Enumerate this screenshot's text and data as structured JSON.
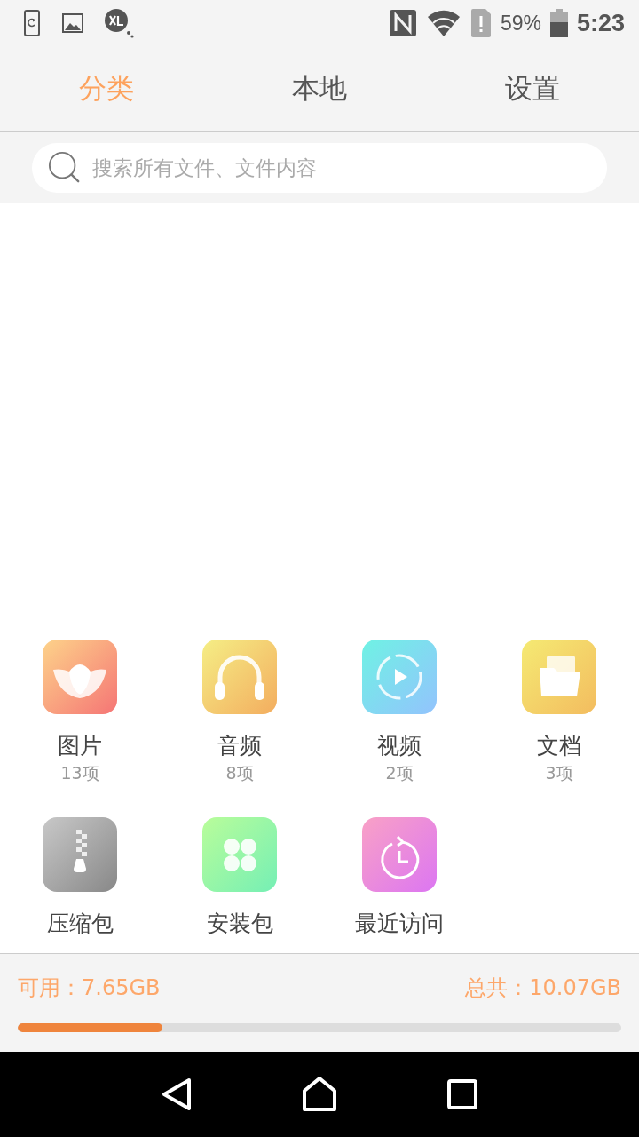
{
  "status_bar": {
    "battery_text": "59%",
    "time": "5:23"
  },
  "tabs": [
    {
      "label": "分类",
      "selected": true
    },
    {
      "label": "本地",
      "selected": false
    },
    {
      "label": "设置",
      "selected": false
    }
  ],
  "search": {
    "placeholder": "搜索所有文件、文件内容"
  },
  "categories": [
    {
      "kind": "pictures",
      "label": "图片",
      "count": "13项"
    },
    {
      "kind": "audio",
      "label": "音频",
      "count": "8项"
    },
    {
      "kind": "video",
      "label": "视频",
      "count": "2项"
    },
    {
      "kind": "documents",
      "label": "文档",
      "count": "3项"
    },
    {
      "kind": "archives",
      "label": "压缩包"
    },
    {
      "kind": "apps",
      "label": "安装包"
    },
    {
      "kind": "recent",
      "label": "最近访问"
    }
  ],
  "storage": {
    "available": "可用：7.65GB",
    "total": "总共：10.07GB",
    "level": 0.24
  }
}
